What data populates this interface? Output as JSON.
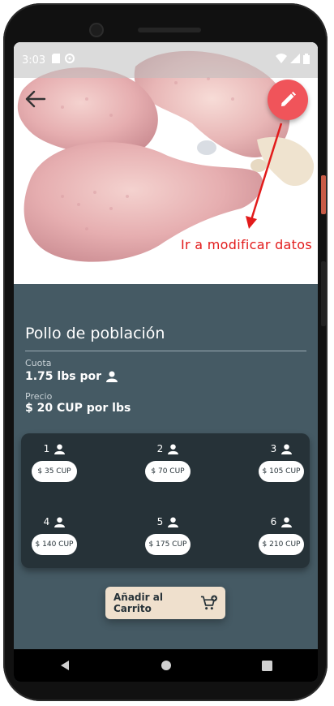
{
  "status_bar": {
    "time": "3:03",
    "icons": [
      "sd-card-icon",
      "sync-icon",
      "wifi-icon",
      "signal-icon",
      "battery-icon"
    ]
  },
  "annotation": {
    "text": "Ir a modificar datos",
    "color": "#e21b1b"
  },
  "product": {
    "title": "Pollo de población",
    "cuota_label": "Cuota",
    "cuota_value": "1.75 lbs por",
    "precio_label": "Precio",
    "precio_value": "$ 20 CUP por lbs"
  },
  "quantities": [
    {
      "qty": "1",
      "price": "$ 35 CUP"
    },
    {
      "qty": "2",
      "price": "$ 70 CUP"
    },
    {
      "qty": "3",
      "price": "$ 105 CUP"
    },
    {
      "qty": "4",
      "price": "$ 140 CUP"
    },
    {
      "qty": "5",
      "price": "$ 175 CUP"
    },
    {
      "qty": "6",
      "price": "$ 210 CUP"
    }
  ],
  "actions": {
    "add_to_cart_label": "Añadir al Carrito"
  },
  "colors": {
    "background": "#455a64",
    "card": "#263238",
    "fab": "#f0545a",
    "cart_button": "#efe0cd"
  }
}
